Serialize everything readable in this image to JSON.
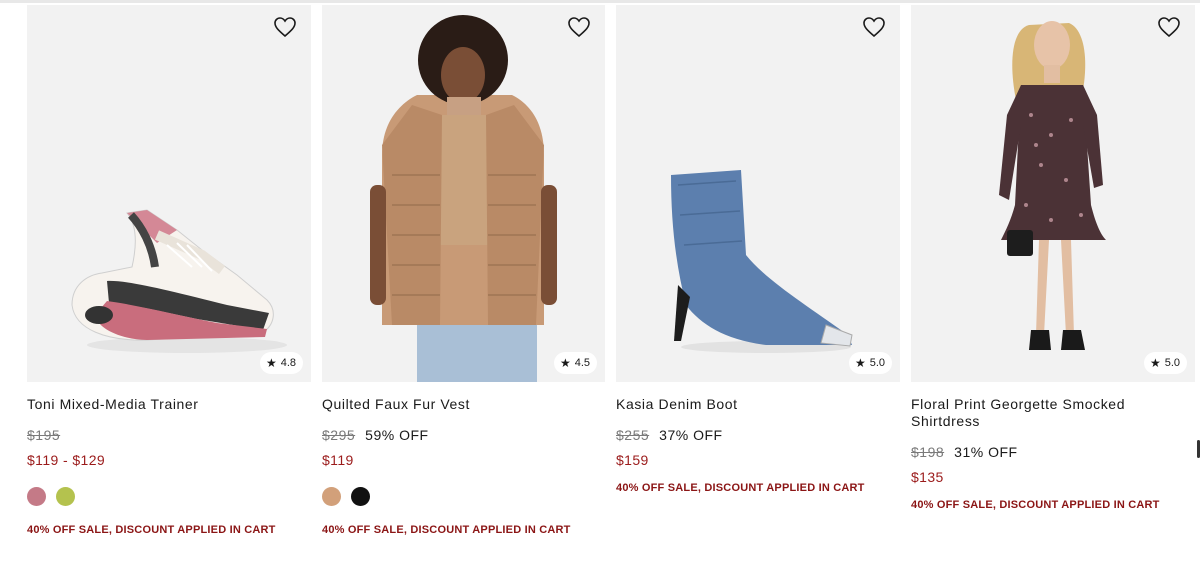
{
  "products": [
    {
      "name": "Toni Mixed-Media Trainer",
      "original_price": "$195",
      "discount": "",
      "sale_price": "$119 - $129",
      "rating": "4.8",
      "swatches": [
        "#c47a87",
        "#b4c24e"
      ],
      "promo": "40% OFF SALE, DISCOUNT APPLIED IN CART"
    },
    {
      "name": "Quilted Faux Fur Vest",
      "original_price": "$295",
      "discount": "59% OFF",
      "sale_price": "$119",
      "rating": "4.5",
      "swatches": [
        "#d2a07a",
        "#111111"
      ],
      "promo": "40% OFF SALE, DISCOUNT APPLIED IN CART"
    },
    {
      "name": "Kasia Denim Boot",
      "original_price": "$255",
      "discount": "37% OFF",
      "sale_price": "$159",
      "rating": "5.0",
      "swatches": [],
      "promo": "40% OFF SALE, DISCOUNT APPLIED IN CART"
    },
    {
      "name": "Floral Print Georgette Smocked Shirtdress",
      "original_price": "$198",
      "discount": "31% OFF",
      "sale_price": "$135",
      "rating": "5.0",
      "swatches": [],
      "promo": "40% OFF SALE, DISCOUNT APPLIED IN CART"
    }
  ],
  "icons": {
    "favorite": "heart-icon",
    "rating": "star-icon"
  },
  "colors": {
    "sale_price": "#9b1b1b",
    "promo": "#8b1515"
  }
}
